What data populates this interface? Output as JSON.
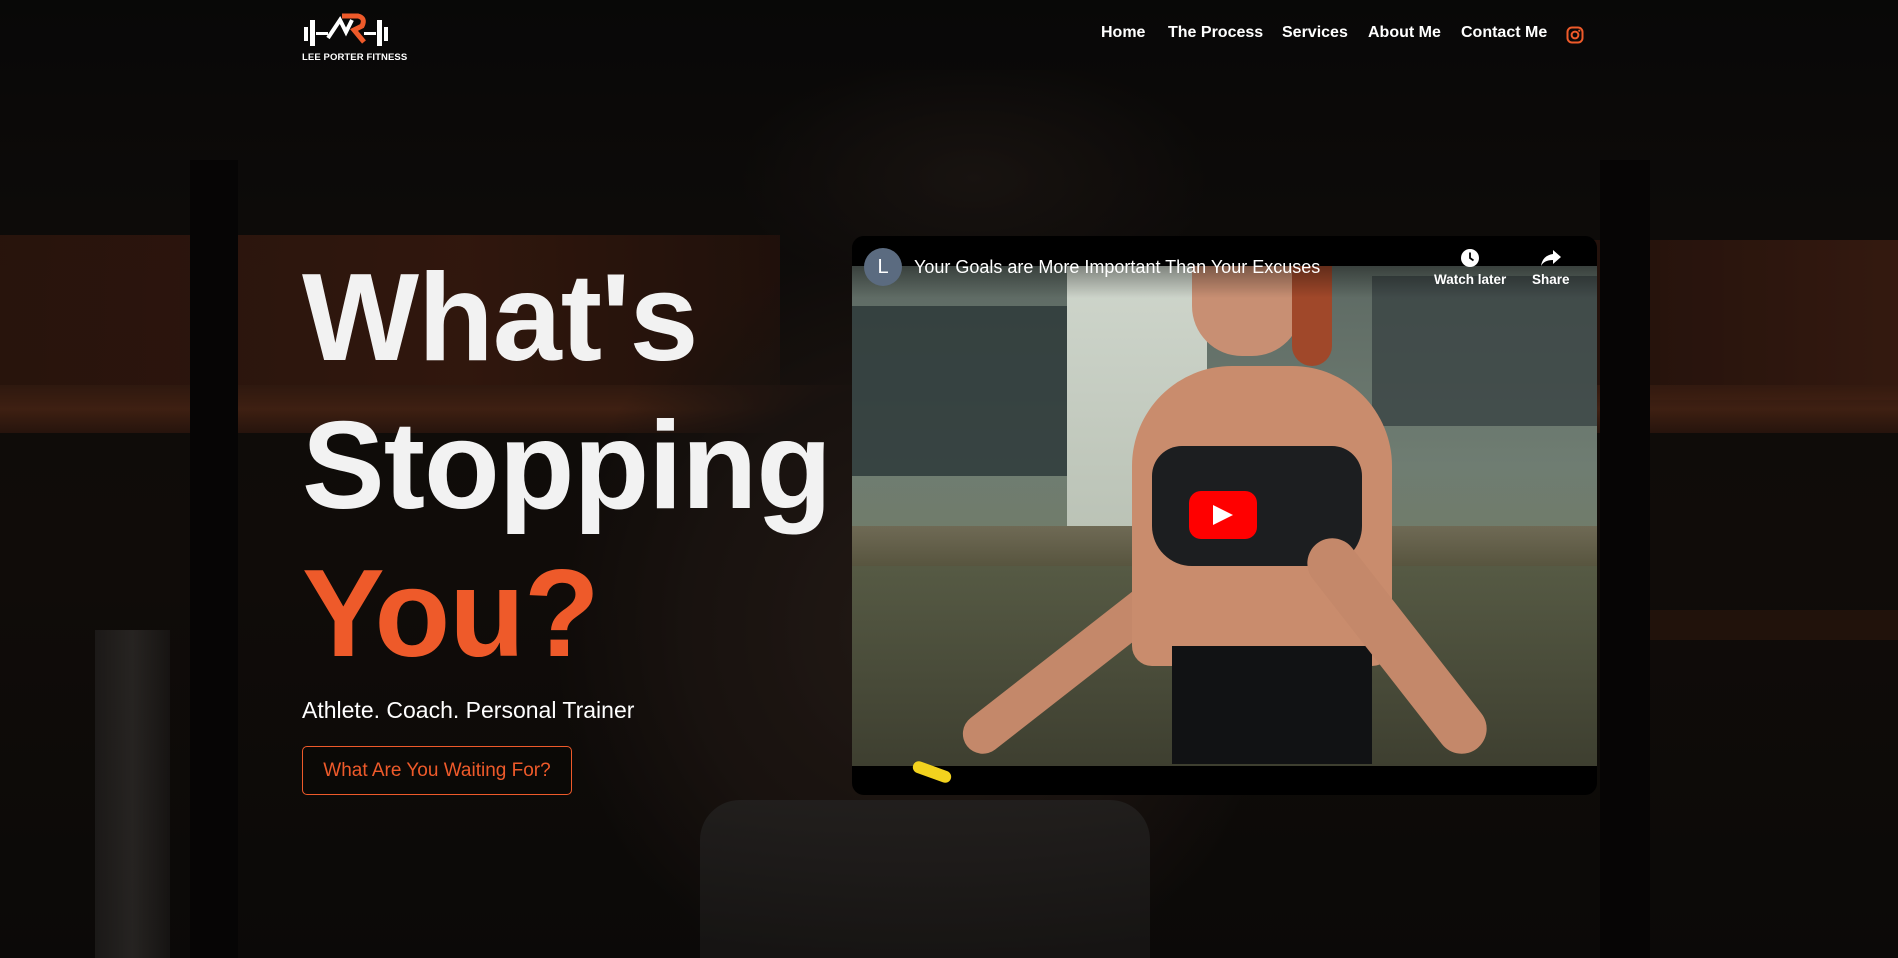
{
  "brand": {
    "name": "LEE PORTER FITNESS",
    "accent_color": "#ee5a2a"
  },
  "nav": {
    "items": [
      "Home",
      "The Process",
      "Services",
      "About Me",
      "Contact Me"
    ],
    "instagram_icon": "instagram-icon"
  },
  "hero": {
    "title_line1": "What's",
    "title_line2": "Stopping",
    "title_line3": "You?",
    "subtitle": "Athlete. Coach. Personal Trainer",
    "cta_label": "What Are You Waiting For?"
  },
  "video": {
    "channel_initial": "L",
    "title": "Your Goals are More Important Than Your Excuses",
    "watch_later_label": "Watch later",
    "share_label": "Share",
    "play_icon": "youtube-play-icon"
  }
}
